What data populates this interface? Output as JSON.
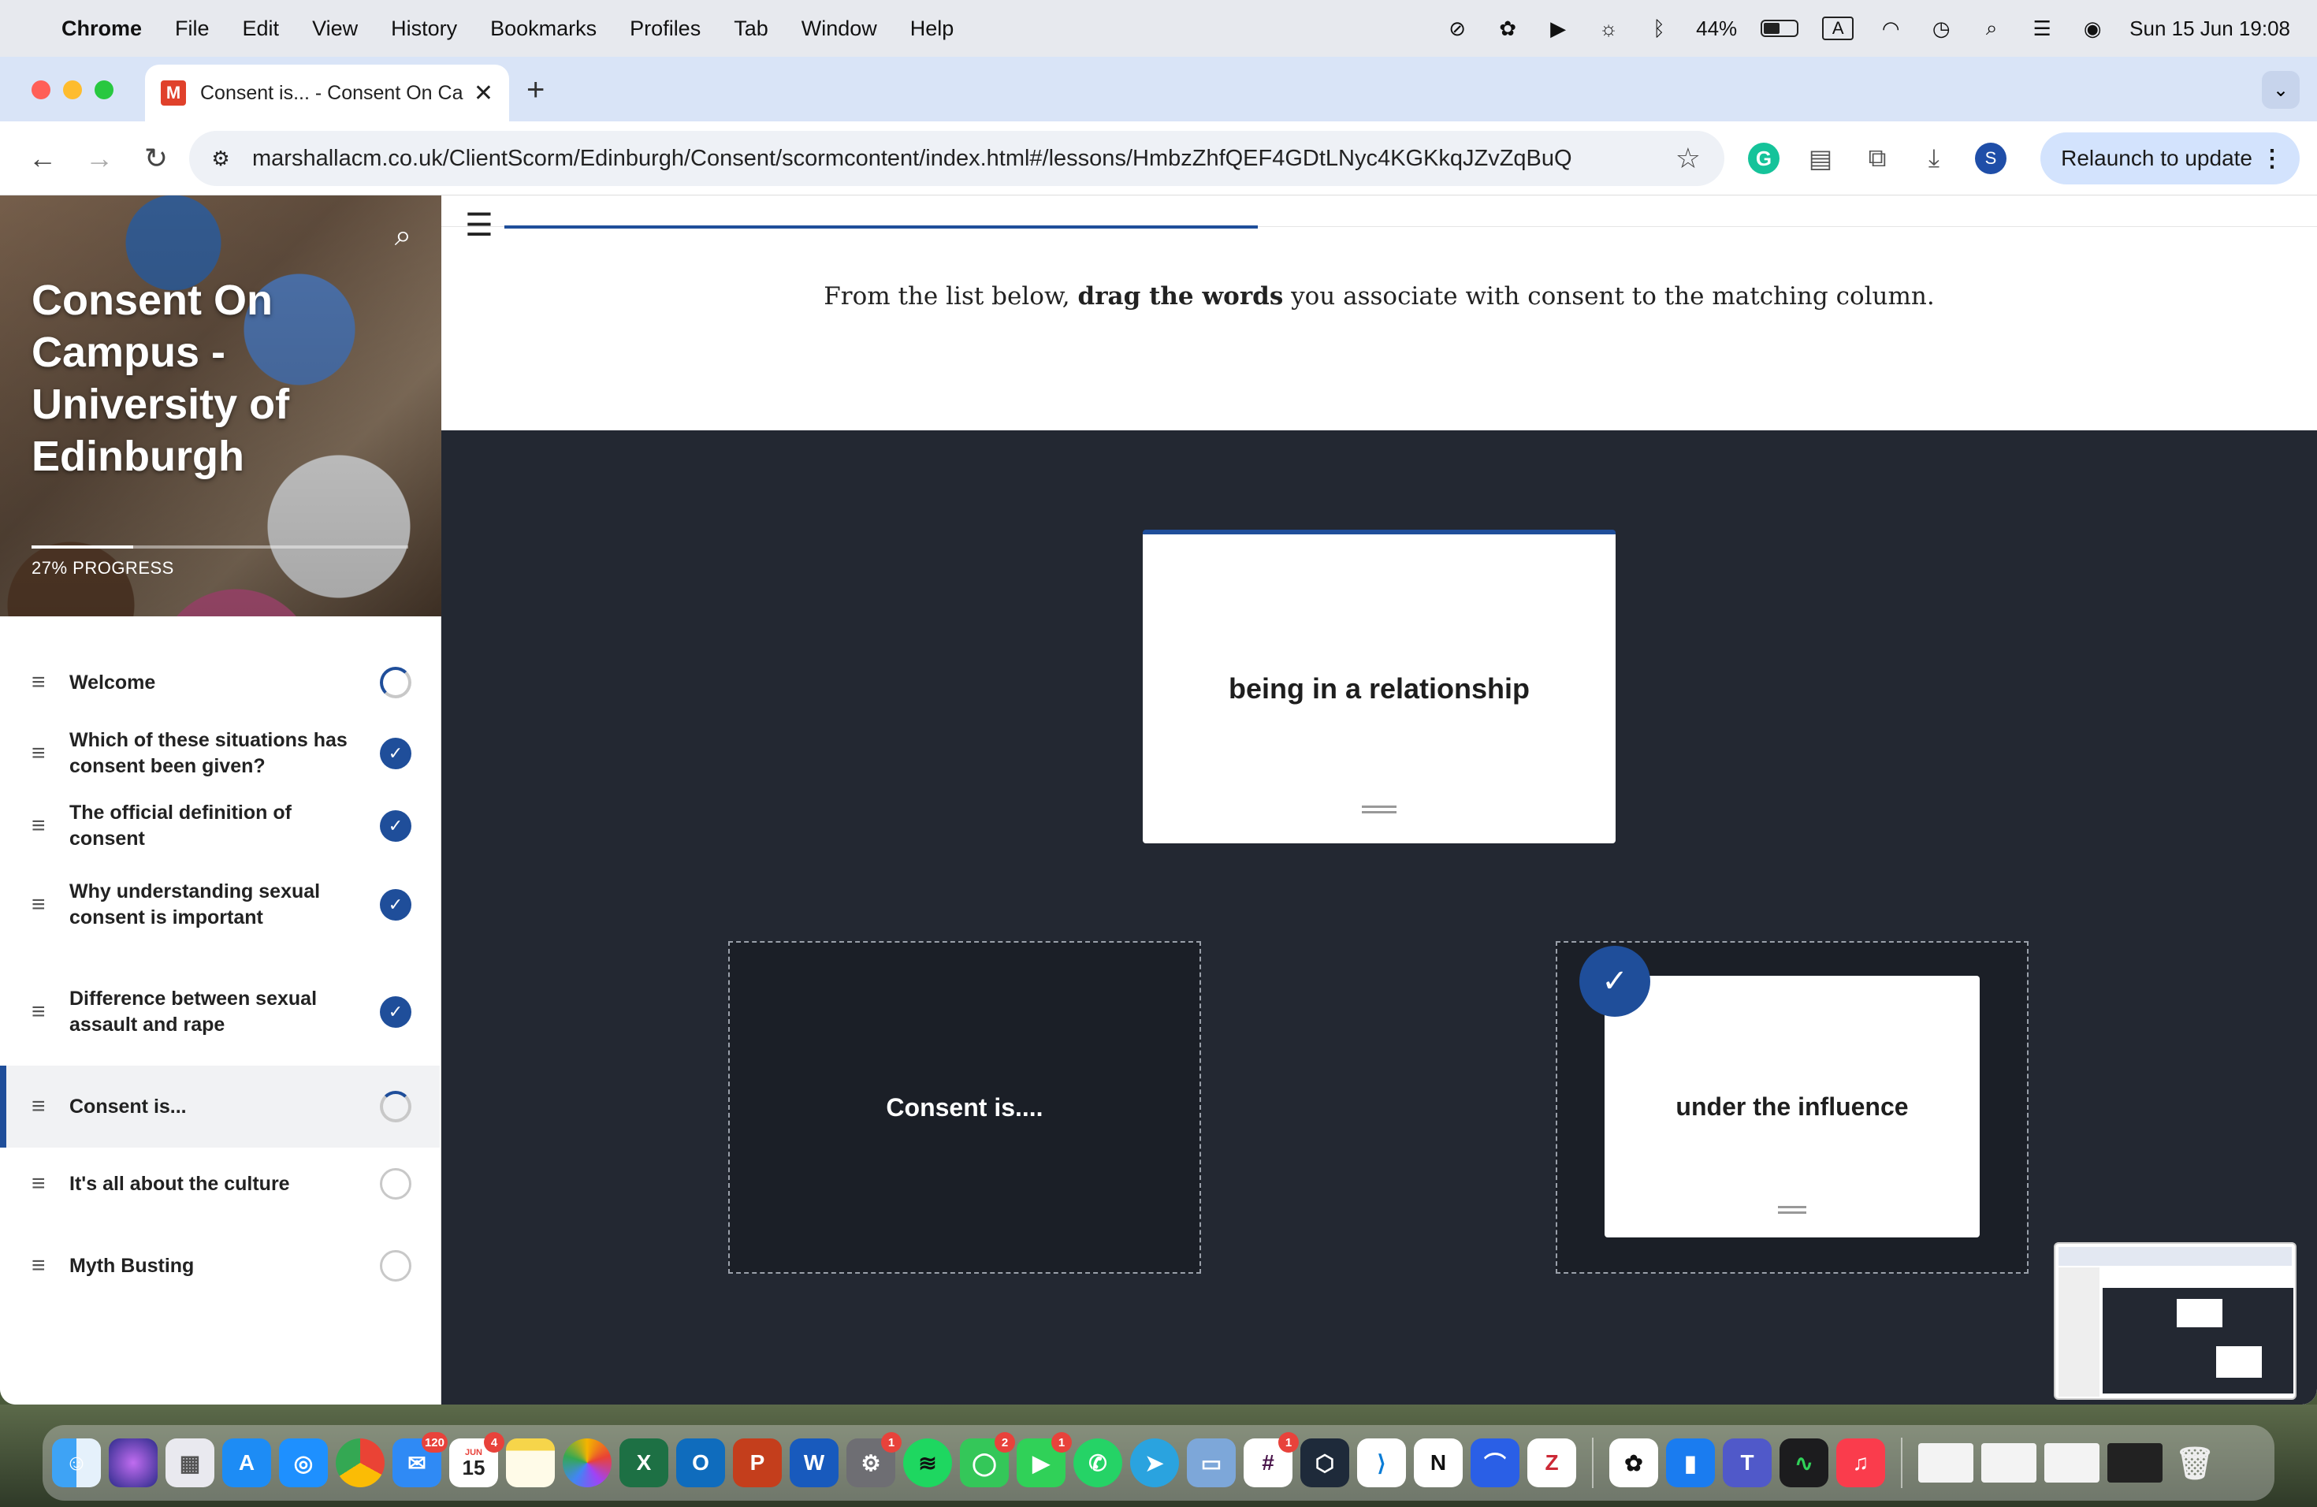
{
  "menubar": {
    "app": "Chrome",
    "items": [
      "File",
      "Edit",
      "View",
      "History",
      "Bookmarks",
      "Profiles",
      "Tab",
      "Window",
      "Help"
    ],
    "battery": "44%",
    "input_source": "A",
    "datetime": "Sun 15 Jun  19:08"
  },
  "browser": {
    "tab_title": "Consent is... - Consent On Ca",
    "favicon": "M",
    "url": "marshallacm.co.uk/ClientScorm/Edinburgh/Consent/scormcontent/index.html#/lessons/HmbzZhfQEF4GDtLNyc4KGKkqJZvZqBuQ",
    "profile_initial": "S",
    "relaunch_label": "Relaunch to update"
  },
  "course": {
    "title": "Consent On Campus - University of Edinburgh",
    "progress_label": "27% PROGRESS",
    "progress_fraction": 0.27
  },
  "lessons": [
    {
      "label": "Welcome",
      "status": "in-progress"
    },
    {
      "label": "Which of these situations has consent been given?",
      "status": "complete"
    },
    {
      "label": "The official definition of consent",
      "status": "complete"
    },
    {
      "label": "Why understanding sexual consent is important",
      "status": "complete"
    },
    {
      "label": "Difference between sexual assault and rape",
      "status": "complete"
    },
    {
      "label": "Consent is...",
      "status": "in-progress",
      "active": true
    },
    {
      "label": "It's all about the culture",
      "status": "not-started"
    },
    {
      "label": "Myth Busting",
      "status": "not-started"
    }
  ],
  "activity": {
    "instruction_prefix": "From the list below, ",
    "instruction_bold": "drag the words",
    "instruction_suffix": " you associate with consent to the matching column.",
    "draggable_card": "being in a relationship",
    "dropzone_left_label": "Consent is....",
    "placed_card": "under the influence"
  },
  "dock": {
    "badges": {
      "mail": "120",
      "calendar_day": "15",
      "calendar_month": "JUN",
      "calendar_badge": "4",
      "settings": "1",
      "messages": "2",
      "facetime": "1",
      "slack": "1"
    }
  }
}
